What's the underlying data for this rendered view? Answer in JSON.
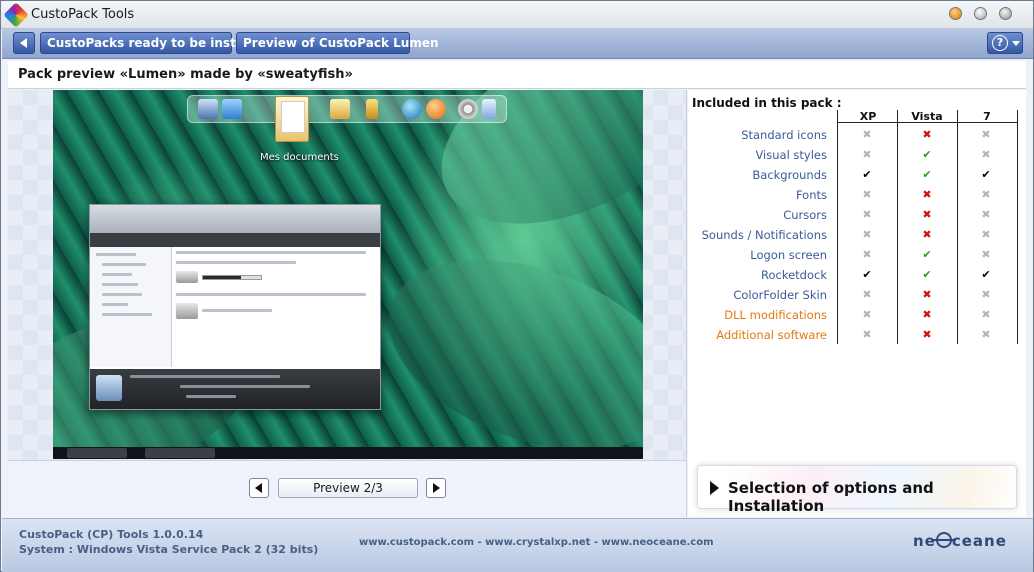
{
  "window": {
    "title": "CustoPack Tools"
  },
  "nav": {
    "breadcrumbs": [
      "CustoPacks ready to be installed",
      "Preview of CustoPack Lumen"
    ],
    "help_label": "?"
  },
  "header": {
    "title": "Pack preview «Lumen» made by «sweatyfish»"
  },
  "preview": {
    "desktop_label": "Mes documents",
    "counter_label": "Preview 2/3"
  },
  "included": {
    "title": "Included in this pack :",
    "columns": [
      "XP",
      "Vista",
      "7"
    ],
    "status_legend": {
      "yes": "✔",
      "no": "✖",
      "na": "✖",
      "partial": "✔"
    },
    "rows": [
      {
        "label": "Standard icons",
        "highlight": false,
        "status": [
          "na",
          "no",
          "na"
        ]
      },
      {
        "label": "Visual styles",
        "highlight": false,
        "status": [
          "na",
          "yes",
          "na"
        ]
      },
      {
        "label": "Backgrounds",
        "highlight": false,
        "status": [
          "partial",
          "yes",
          "partial"
        ]
      },
      {
        "label": "Fonts",
        "highlight": false,
        "status": [
          "na",
          "no",
          "na"
        ]
      },
      {
        "label": "Cursors",
        "highlight": false,
        "status": [
          "na",
          "no",
          "na"
        ]
      },
      {
        "label": "Sounds / Notifications",
        "highlight": false,
        "status": [
          "na",
          "no",
          "na"
        ]
      },
      {
        "label": "Logon screen",
        "highlight": false,
        "status": [
          "na",
          "yes",
          "na"
        ]
      },
      {
        "label": "Rocketdock",
        "highlight": false,
        "status": [
          "partial",
          "yes",
          "partial"
        ]
      },
      {
        "label": "ColorFolder Skin",
        "highlight": false,
        "status": [
          "na",
          "no",
          "na"
        ]
      },
      {
        "label": "DLL modifications",
        "highlight": true,
        "status": [
          "na",
          "no",
          "na"
        ]
      },
      {
        "label": "Additional software",
        "highlight": true,
        "status": [
          "na",
          "no",
          "na"
        ]
      }
    ]
  },
  "install_button": {
    "label": "Selection of options and Installation"
  },
  "footer": {
    "version": "CustoPack (CP) Tools 1.0.0.14",
    "system": "System : Windows Vista Service Pack 2 (32 bits)",
    "links": "www.custopack.com - www.crystalxp.net - www.neoceane.com",
    "logo_text_left": "ne",
    "logo_text_right": "ceane"
  },
  "colors": {
    "accent_blue": "#3457a3",
    "link_blue": "#3b5a9a",
    "highlight_orange": "#e07a10",
    "status_no": "#d01010",
    "status_yes": "#2e9a18"
  }
}
